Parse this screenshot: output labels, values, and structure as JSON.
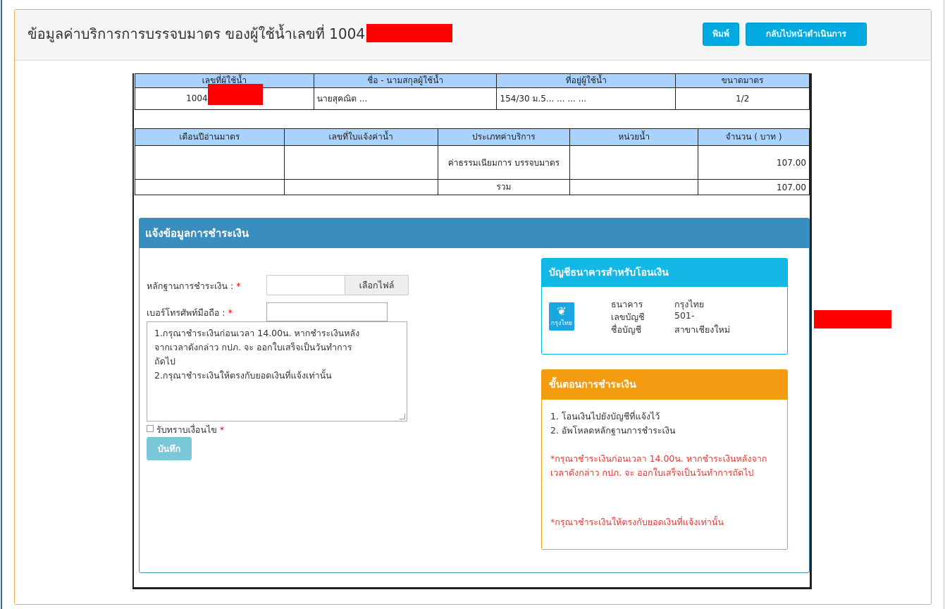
{
  "header": {
    "title": "ข้อมูลค่าบริการการบรรจบมาตร ของผู้ใช้น้ำเลขที่ 1004",
    "print_label": "พิมพ์",
    "back_label": "กลับไปหน้าดำเนินการ"
  },
  "user_table": {
    "headers": [
      "เลขที่ผู้ใช้น้ำ",
      "ชื่อ - นามสกุลผู้ใช้น้ำ",
      "ที่อยู่ผู้ใช้น้ำ",
      "ขนาดมาตร"
    ],
    "row": {
      "user_no": "1004",
      "name": "นายสุคณิต ...",
      "address": "154/30 ม.5... ... ... ...",
      "meter_size": "1/2"
    }
  },
  "fee_table": {
    "headers": [
      "เดือนปีอ่านมาตร",
      "เลขที่ใบแจ้งค่าน้ำ",
      "ประเภทค่าบริการ",
      "หน่วยน้ำ",
      "จำนวน ( บาท )"
    ],
    "rows": [
      {
        "month": "",
        "bill_no": "",
        "type": "ค่าธรรมเนียมการ บรรจบมาตร",
        "units": "",
        "amount": "107.00"
      },
      {
        "month": "",
        "bill_no": "",
        "type": "รวม",
        "units": "",
        "amount": "107.00"
      }
    ]
  },
  "payment": {
    "heading": "แจ้งข้อมูลการชำระเงิน",
    "proof_label": "หลักฐานการชำระเงิน :",
    "file_button": "เลือกไฟล์",
    "phone_label": "เบอร์โทรศัพท์มือถือ :",
    "required_mark": "*",
    "notes": "1.กรุณาชำระเงินก่อนเวลา 14.00น. หากชำระเงินหลัง\nจากเวลาดังกล่าว กปภ. จะ ออกใบเสร็จเป็นวันทำการ\nถัดไป\n2.กรุณาชำระเงินให้ตรงกับยอดเงินที่แจ้งเท่านั้น",
    "accept_label": "รับทราบเงื่อนไข",
    "save_label": "บันทึก"
  },
  "bank": {
    "heading": "บัญชีธนาคารสำหรับโอนเงิน",
    "logo_text": "กรุงไทย",
    "bank_label": "ธนาคาร",
    "bank_value": "กรุงไทย",
    "account_label": "เลขบัญชี",
    "account_value": "501-",
    "name_label": "ชื่อบัญชี",
    "name_value": "สาขาเชียงใหม่"
  },
  "steps": {
    "heading": "ขั้นตอนการชำระเงิน",
    "items": [
      "1. โอนเงินไปยังบัญชีที่แจ้งไว้",
      "2. อัพโหลดหลักฐานการชำระเงิน"
    ],
    "warning1": "*กรุณาชำระเงินก่อนเวลา 14.00น. หากชำระเงินหลังจากเวลาดังกล่าว กปภ. จะ ออกใบเสร็จเป็นวันทำการถัดไป",
    "warning2": "*กรุณาชำระเงินให้ตรงกับยอดเงินที่แจ้งเท่านั้น"
  },
  "colors": {
    "info_button": "#00a9e0",
    "table_header": "#a9d2ff",
    "payment_heading": "#3a8ebf",
    "bank_heading": "#14b8e6",
    "steps_heading": "#f39c12",
    "warning_text": "#e03a2f",
    "redaction": "#ff0000"
  }
}
